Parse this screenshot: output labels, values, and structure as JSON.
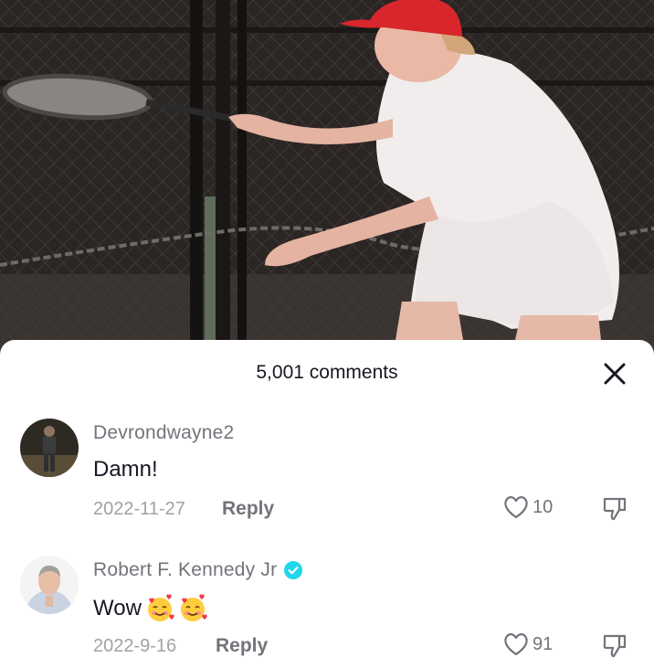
{
  "comments_panel": {
    "count_label": "5,001 comments",
    "close_icon": "close-icon"
  },
  "comments": [
    {
      "username": "Devrondwayne2",
      "verified": false,
      "text": "Damn!",
      "date": "2022-11-27",
      "reply_label": "Reply",
      "likes": "10"
    },
    {
      "username": "Robert F. Kennedy Jr",
      "verified": true,
      "text": "Wow",
      "emojis": [
        "smiling-face-with-hearts",
        "smiling-face-with-hearts"
      ],
      "date": "2022-9-16",
      "reply_label": "Reply",
      "likes": "91"
    }
  ],
  "colors": {
    "verified_badge": "#20d5ec",
    "secondary_text": "#73747b",
    "date_text": "#a1a2a7",
    "primary_text": "#161823"
  }
}
